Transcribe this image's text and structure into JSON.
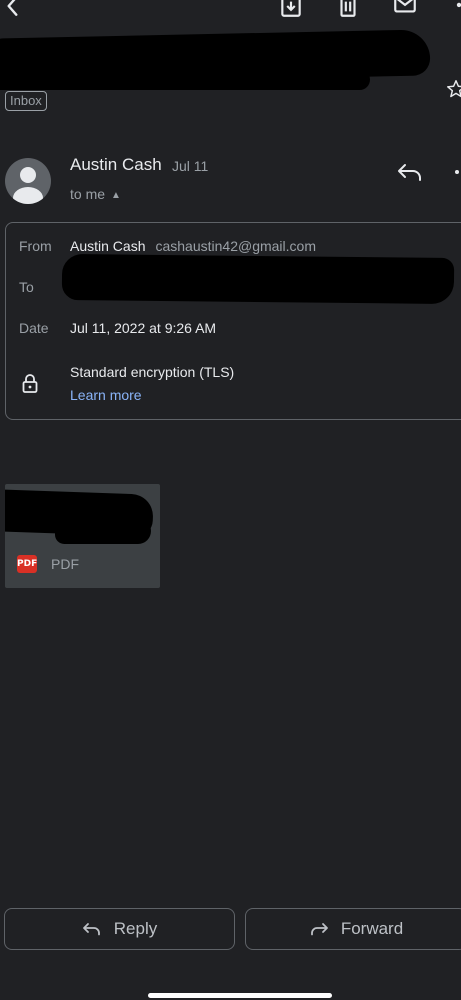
{
  "toolbar": {
    "back_icon": "back-arrow-icon",
    "archive_icon": "archive-icon",
    "delete_icon": "trash-icon",
    "mark_unread_icon": "mail-icon",
    "more_icon": "more-vert-icon"
  },
  "thread": {
    "label": "Inbox",
    "star_icon": "star-outline-icon"
  },
  "message": {
    "sender_name": "Austin Cash",
    "date": "Jul 11",
    "recipient_summary": "to me",
    "reply_icon": "reply-icon",
    "more_icon": "more-vert-icon"
  },
  "details": {
    "from_label": "From",
    "from_name": "Austin Cash",
    "from_email": "cashaustin42@gmail.com",
    "to_label": "To",
    "date_label": "Date",
    "date_value": "Jul 11, 2022 at 9:26 AM",
    "encryption": "Standard encryption (TLS)",
    "learn_more": "Learn more"
  },
  "attachment": {
    "type_badge": "PDF",
    "type_label": "PDF"
  },
  "actions": {
    "reply_label": "Reply",
    "forward_label": "Forward"
  },
  "colors": {
    "background": "#202124",
    "link": "#8ab4f8",
    "pdf_red": "#d93025"
  }
}
